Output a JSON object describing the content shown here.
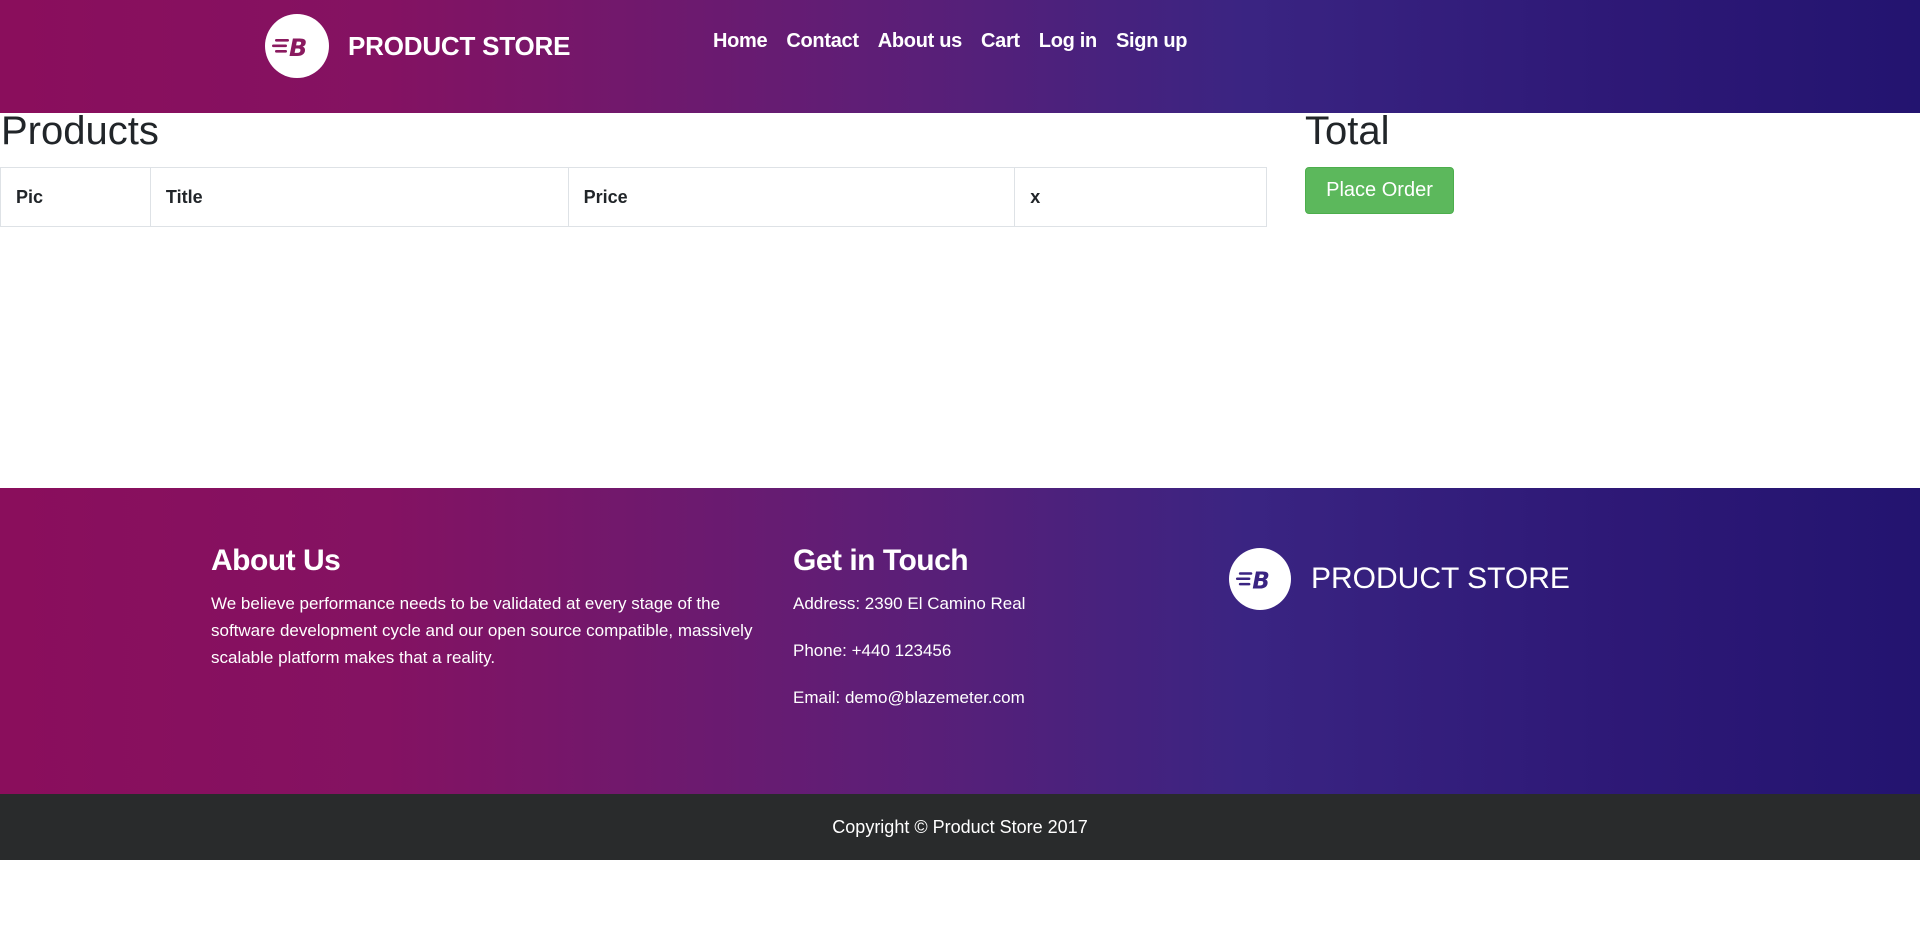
{
  "header": {
    "brand": "PRODUCT STORE",
    "logo_icon": "blazemeter-logo-icon",
    "nav": [
      {
        "label": "Home"
      },
      {
        "label": "Contact"
      },
      {
        "label": "About us"
      },
      {
        "label": "Cart"
      },
      {
        "label": "Log in"
      },
      {
        "label": "Sign up"
      }
    ]
  },
  "main": {
    "products_title": "Products",
    "table_headers": [
      "Pic",
      "Title",
      "Price",
      "x"
    ],
    "total_title": "Total",
    "place_order_label": "Place Order"
  },
  "footer": {
    "about_title": "About Us",
    "about_text": "We believe performance needs to be validated at every stage of the software development cycle and our open source compatible, massively scalable platform makes that a reality.",
    "touch_title": "Get in Touch",
    "address": "Address: 2390 El Camino Real",
    "phone": "Phone: +440 123456",
    "email": "Email: demo@blazemeter.com",
    "brand": "PRODUCT STORE",
    "copyright": "Copyright © Product Store 2017"
  },
  "colors": {
    "gradient_start": "#8a0e5c",
    "gradient_end": "#231470",
    "success": "#5cb85c",
    "copyright_bg": "#292b2c"
  }
}
